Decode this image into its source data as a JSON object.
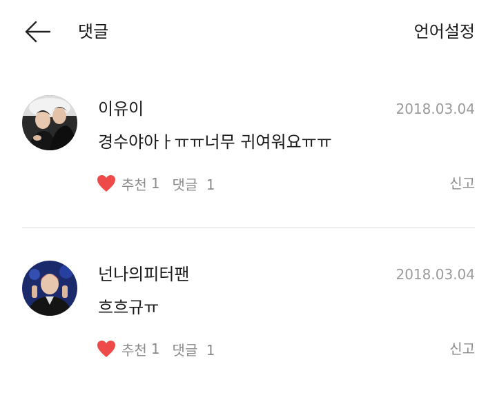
{
  "header": {
    "title": "댓글",
    "language_label": "언어설정",
    "back_icon": "back-arrow-icon"
  },
  "comments": [
    {
      "username": "이유이",
      "date": "2018.03.04",
      "text": "경수야아ㅏㅠㅠ너무 귀여워요ㅠㅠ",
      "like_label": "추천",
      "like_count": "1",
      "reply_label": "댓글",
      "reply_count": "1",
      "report_label": "신고"
    },
    {
      "username": "넌나의피터팬",
      "date": "2018.03.04",
      "text": "흐흐규ㅠ",
      "like_label": "추천",
      "like_count": "1",
      "reply_label": "댓글",
      "reply_count": "1",
      "report_label": "신고"
    }
  ],
  "colors": {
    "heart": "#ef4a4a",
    "muted_text": "#8a8a8a",
    "date_text": "#9a9a9a",
    "divider": "#e2e2e2"
  }
}
